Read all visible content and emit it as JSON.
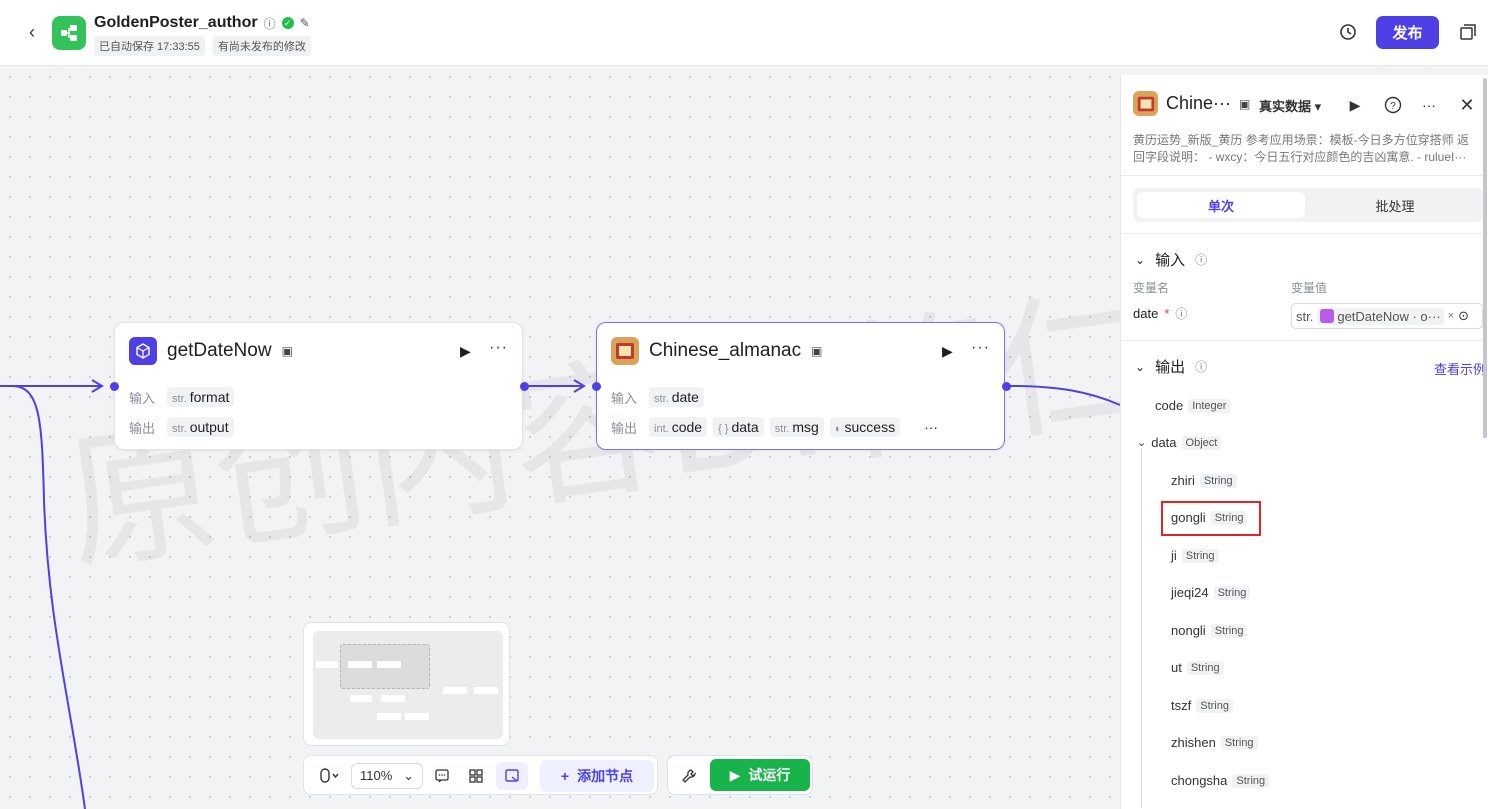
{
  "header": {
    "title": "GoldenPoster_author",
    "autosave": "已自动保存 17:33:55",
    "unpublished": "有尚未发布的修改",
    "publish_label": "发布"
  },
  "nodes": {
    "getDateNow": {
      "title": "getDateNow",
      "input_label": "输入",
      "output_label": "输出",
      "inputs": [
        {
          "type": "str.",
          "name": "format"
        }
      ],
      "outputs": [
        {
          "type": "str.",
          "name": "output"
        }
      ]
    },
    "almanac": {
      "title": "Chinese_almanac",
      "input_label": "输入",
      "output_label": "输出",
      "inputs": [
        {
          "type": "str.",
          "name": "date"
        }
      ],
      "outputs": [
        {
          "type": "int.",
          "name": "code"
        },
        {
          "type": "{ }",
          "name": "data"
        },
        {
          "type": "str.",
          "name": "msg"
        },
        {
          "type": "toggle",
          "name": "success"
        }
      ]
    }
  },
  "toolbar": {
    "zoom": "110%",
    "add_node_label": "添加节点",
    "run_label": "试运行"
  },
  "panel": {
    "title": "Chine···",
    "mode": "真实数据",
    "desc_line1": "黄历运势_新版_黄历 参考应用场景：模板-今日多方位穿搭师 返",
    "desc_line2": "回字段说明： - wxcy：今日五行对应颜色的吉凶寓意. - rulueI···",
    "tab_single": "单次",
    "tab_batch": "批处理",
    "input_section": "输入",
    "col_name": "变量名",
    "col_value": "变量值",
    "var_name": "date",
    "var_type": "str.",
    "var_ref": "getDateNow · o···",
    "output_section": "输出",
    "view_example": "查看示例",
    "outputs": [
      {
        "name": "code",
        "type": "Integer"
      },
      {
        "name": "data",
        "type": "Object"
      },
      {
        "name": "zhiri",
        "type": "String"
      },
      {
        "name": "gongli",
        "type": "String"
      },
      {
        "name": "ji",
        "type": "String"
      },
      {
        "name": "jieqi24",
        "type": "String"
      },
      {
        "name": "nongli",
        "type": "String"
      },
      {
        "name": "ut",
        "type": "String"
      },
      {
        "name": "tszf",
        "type": "String"
      },
      {
        "name": "zhishen",
        "type": "String"
      },
      {
        "name": "chongsha",
        "type": "String"
      }
    ]
  },
  "watermark": "原创内容BY简仁杰",
  "colors": {
    "accent": "#4e40e5",
    "run_green": "#18b34a",
    "highlight": "#e0242b"
  }
}
